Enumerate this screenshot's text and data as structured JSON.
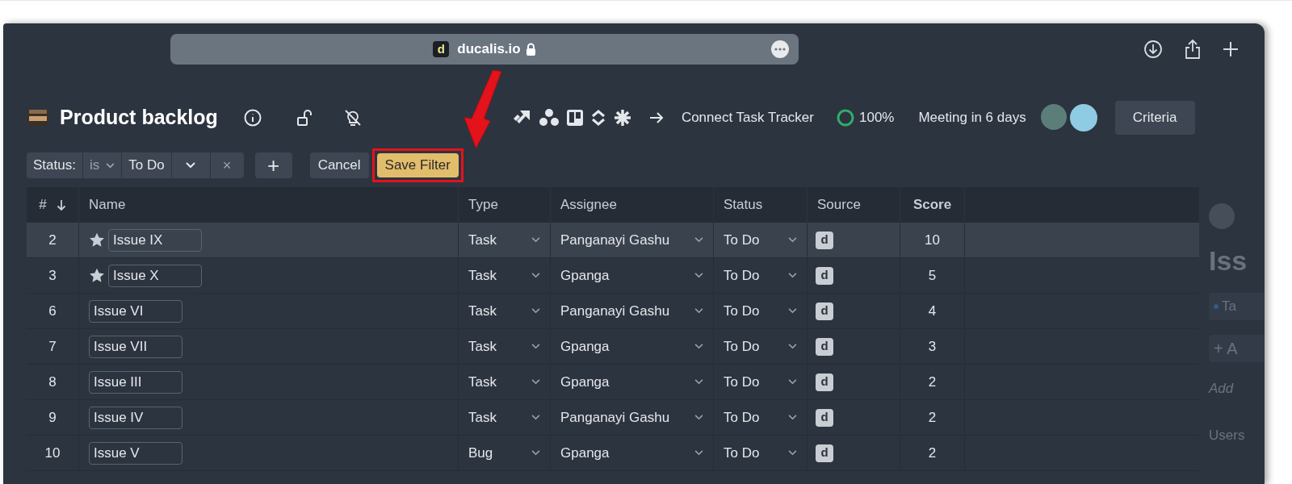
{
  "browser": {
    "address": "ducalis.io",
    "site_badge": "d"
  },
  "header": {
    "title": "Product backlog",
    "connect": "Connect Task Tracker",
    "progress": "100%",
    "meeting": "Meeting in 6 days",
    "criteria_button": "Criteria"
  },
  "filter": {
    "field": "Status:",
    "operator": "is",
    "value": "To Do",
    "remove": "×",
    "add": "+",
    "cancel": "Cancel",
    "save": "Save Filter",
    "save_highlighted": true
  },
  "table": {
    "columns": [
      "#",
      "Name",
      "Type",
      "Assignee",
      "Status",
      "Source",
      "Score"
    ],
    "rows": [
      {
        "num": "2",
        "starred": true,
        "name": "Issue IX",
        "type": "Task",
        "assignee": "Panganayi Gashu",
        "status": "To Do",
        "source": "d",
        "score": "10",
        "selected": true
      },
      {
        "num": "3",
        "starred": true,
        "name": "Issue X",
        "type": "Task",
        "assignee": "Gpanga",
        "status": "To Do",
        "source": "d",
        "score": "5",
        "selected": false
      },
      {
        "num": "6",
        "starred": false,
        "name": "Issue VI",
        "type": "Task",
        "assignee": "Panganayi Gashu",
        "status": "To Do",
        "source": "d",
        "score": "4",
        "selected": false
      },
      {
        "num": "7",
        "starred": false,
        "name": "Issue VII",
        "type": "Task",
        "assignee": "Gpanga",
        "status": "To Do",
        "source": "d",
        "score": "3",
        "selected": false
      },
      {
        "num": "8",
        "starred": false,
        "name": "Issue III",
        "type": "Task",
        "assignee": "Gpanga",
        "status": "To Do",
        "source": "d",
        "score": "2",
        "selected": false
      },
      {
        "num": "9",
        "starred": false,
        "name": "Issue IV",
        "type": "Task",
        "assignee": "Panganayi Gashu",
        "status": "To Do",
        "source": "d",
        "score": "2",
        "selected": false
      },
      {
        "num": "10",
        "starred": false,
        "name": "Issue V",
        "type": "Bug",
        "assignee": "Gpanga",
        "status": "To Do",
        "source": "d",
        "score": "2",
        "selected": false
      }
    ]
  },
  "side_panel": {
    "title": "Iss",
    "tag": "Ta",
    "add": "+ A",
    "description": "Add",
    "users": "Users"
  }
}
